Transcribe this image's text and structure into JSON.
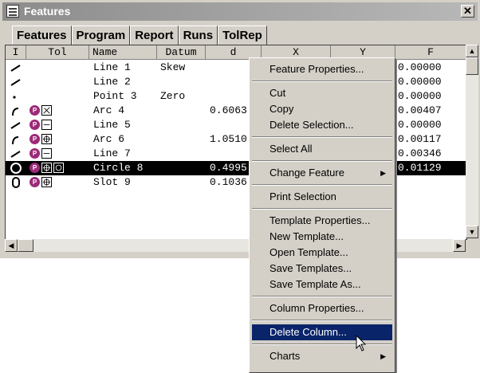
{
  "window": {
    "title": "Features"
  },
  "tabs": [
    "Features",
    "Program",
    "Report",
    "Runs",
    "TolRep"
  ],
  "grid": {
    "columns": [
      "I",
      "Tol",
      "Name",
      "Datum",
      "d",
      "X",
      "Y",
      "F"
    ],
    "rows": [
      {
        "icon": "line-icon",
        "tol": "",
        "name": "Line 1",
        "datum": "Skew",
        "d": "",
        "f": "0.00000"
      },
      {
        "icon": "line-icon",
        "tol": "",
        "name": "Line 2",
        "datum": "",
        "d": "",
        "f": "0.00000"
      },
      {
        "icon": "point-icon",
        "tol": "",
        "name": "Point 3",
        "datum": "Zero",
        "d": "",
        "f": "0.00000"
      },
      {
        "icon": "arc-icon",
        "tol": "angularity-icon",
        "name": "Arc 4",
        "datum": "",
        "d": "0.6063",
        "f": "0.00407"
      },
      {
        "icon": "line-icon",
        "tol": "straightness-icon",
        "name": "Line 5",
        "datum": "",
        "d": "",
        "f": "0.00000"
      },
      {
        "icon": "arc-icon",
        "tol": "position-icon",
        "name": "Arc 6",
        "datum": "",
        "d": "1.0510",
        "f": "0.00117"
      },
      {
        "icon": "line-icon",
        "tol": "straightness-icon",
        "name": "Line 7",
        "datum": "",
        "d": "",
        "f": "0.00346"
      },
      {
        "icon": "circle-icon",
        "tol": "position-circularity-icon",
        "name": "Circle 8",
        "datum": "",
        "d": "0.4995",
        "f": "0.01129",
        "selected": true
      },
      {
        "icon": "slot-icon",
        "tol": "position-icon",
        "name": "Slot 9",
        "datum": "",
        "d": "0.1036",
        "f": ""
      }
    ]
  },
  "context_menu": {
    "items": [
      {
        "label": "Feature Properties..."
      },
      {
        "sep": true
      },
      {
        "label": "Cut"
      },
      {
        "label": "Copy"
      },
      {
        "label": "Delete Selection..."
      },
      {
        "sep": true
      },
      {
        "label": "Select All"
      },
      {
        "sep": true
      },
      {
        "label": "Change Feature",
        "submenu": true
      },
      {
        "sep": true
      },
      {
        "label": "Print Selection"
      },
      {
        "sep": true
      },
      {
        "label": "Template Properties..."
      },
      {
        "label": "New Template..."
      },
      {
        "label": "Open Template..."
      },
      {
        "label": "Save Templates..."
      },
      {
        "label": "Save Template As..."
      },
      {
        "sep": true
      },
      {
        "label": "Column Properties..."
      },
      {
        "sep": true
      },
      {
        "label": "Delete Column...",
        "highlighted": true
      },
      {
        "sep": true
      },
      {
        "label": "Charts",
        "submenu": true
      }
    ]
  },
  "colors": {
    "highlight": "#0a246a",
    "selection": "#000000",
    "badge": "#9c2a78",
    "chrome": "#d4d0c8"
  }
}
